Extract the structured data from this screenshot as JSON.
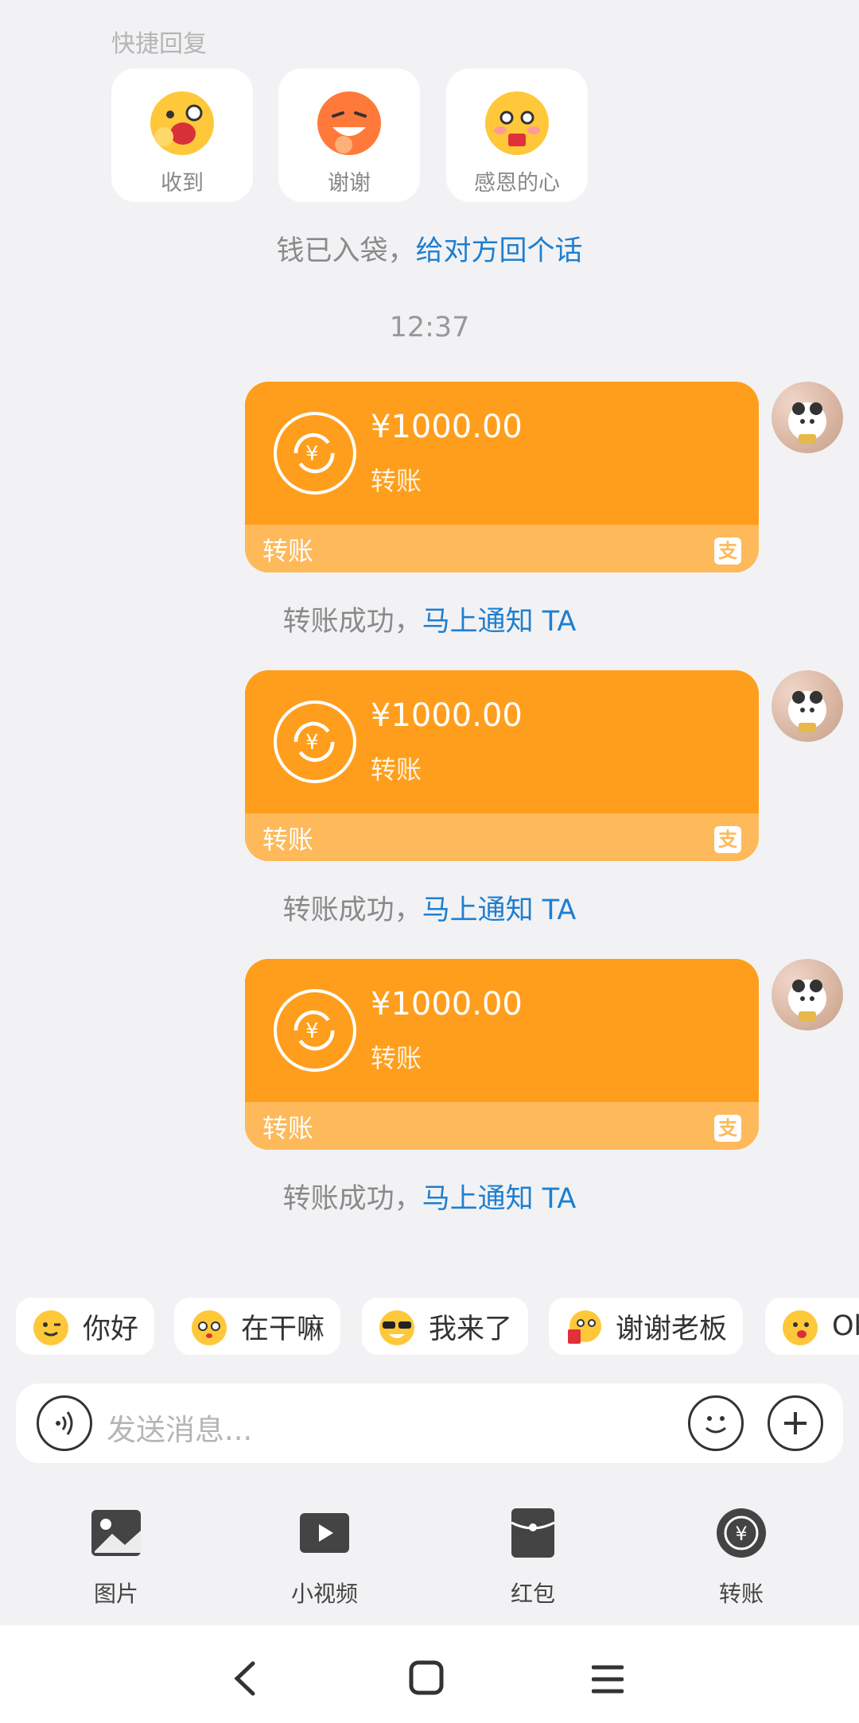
{
  "quick_reply": {
    "title": "快捷回复",
    "items": [
      {
        "label": "收到"
      },
      {
        "label": "谢谢"
      },
      {
        "label": "感恩的心"
      }
    ]
  },
  "received_notice": {
    "text": "钱已入袋，",
    "link": "给对方回个话"
  },
  "timestamp": "12:37",
  "transfers": [
    {
      "amount": "¥1000.00",
      "subtitle": "转账",
      "footer": "转账",
      "status": "转账成功，",
      "status_link": "马上通知 TA"
    },
    {
      "amount": "¥1000.00",
      "subtitle": "转账",
      "footer": "转账",
      "status": "转账成功，",
      "status_link": "马上通知 TA"
    },
    {
      "amount": "¥1000.00",
      "subtitle": "转账",
      "footer": "转账",
      "status": "转账成功，",
      "status_link": "马上通知 TA"
    }
  ],
  "pay_badge": "支",
  "suggestions": [
    {
      "label": "你好"
    },
    {
      "label": "在干嘛"
    },
    {
      "label": "我来了"
    },
    {
      "label": "谢谢老板"
    },
    {
      "label": "Ok"
    }
  ],
  "input": {
    "placeholder": "发送消息..."
  },
  "toolbar": [
    {
      "label": "图片",
      "icon": "image-icon"
    },
    {
      "label": "小视频",
      "icon": "video-icon"
    },
    {
      "label": "红包",
      "icon": "red-packet-icon"
    },
    {
      "label": "转账",
      "icon": "transfer-icon"
    }
  ],
  "colors": {
    "accent": "#ff9e1c",
    "link": "#1e7fd0",
    "background": "#f2f2f4"
  }
}
